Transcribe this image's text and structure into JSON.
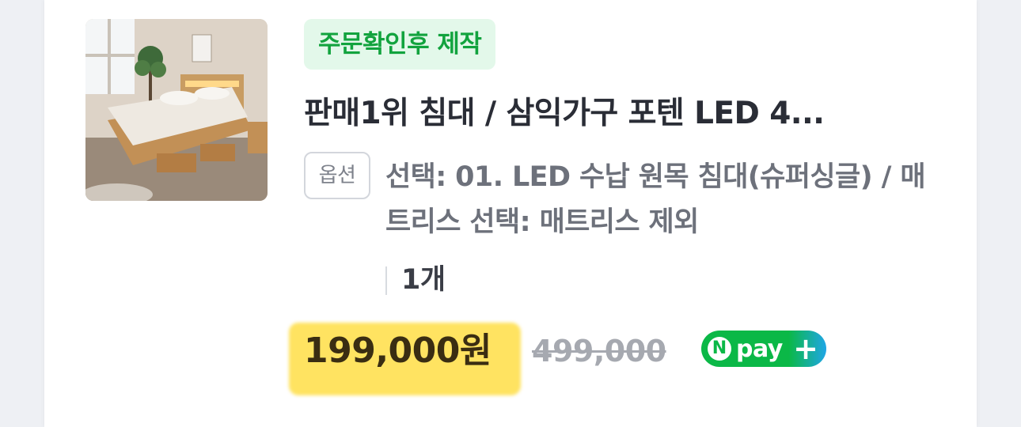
{
  "product": {
    "badge": "주문확인후 제작",
    "title": "판매1위 침대 / 삼익가구 포텐 LED 4...",
    "option_label": "옵션",
    "option_text": "선택: 01. LED 수납 원목 침대(슈퍼싱글) / 매트리스 선택: 매트리스 제외",
    "quantity": "1개",
    "price": "199,000원",
    "original_price": "499,000",
    "payment": {
      "n_letter": "N",
      "label": "pay",
      "plus": "+"
    }
  },
  "colors": {
    "badge_bg": "#e3f8ea",
    "badge_text": "#12a33e",
    "price_highlight": "#ffe361",
    "npay_green": "#0bb847"
  }
}
